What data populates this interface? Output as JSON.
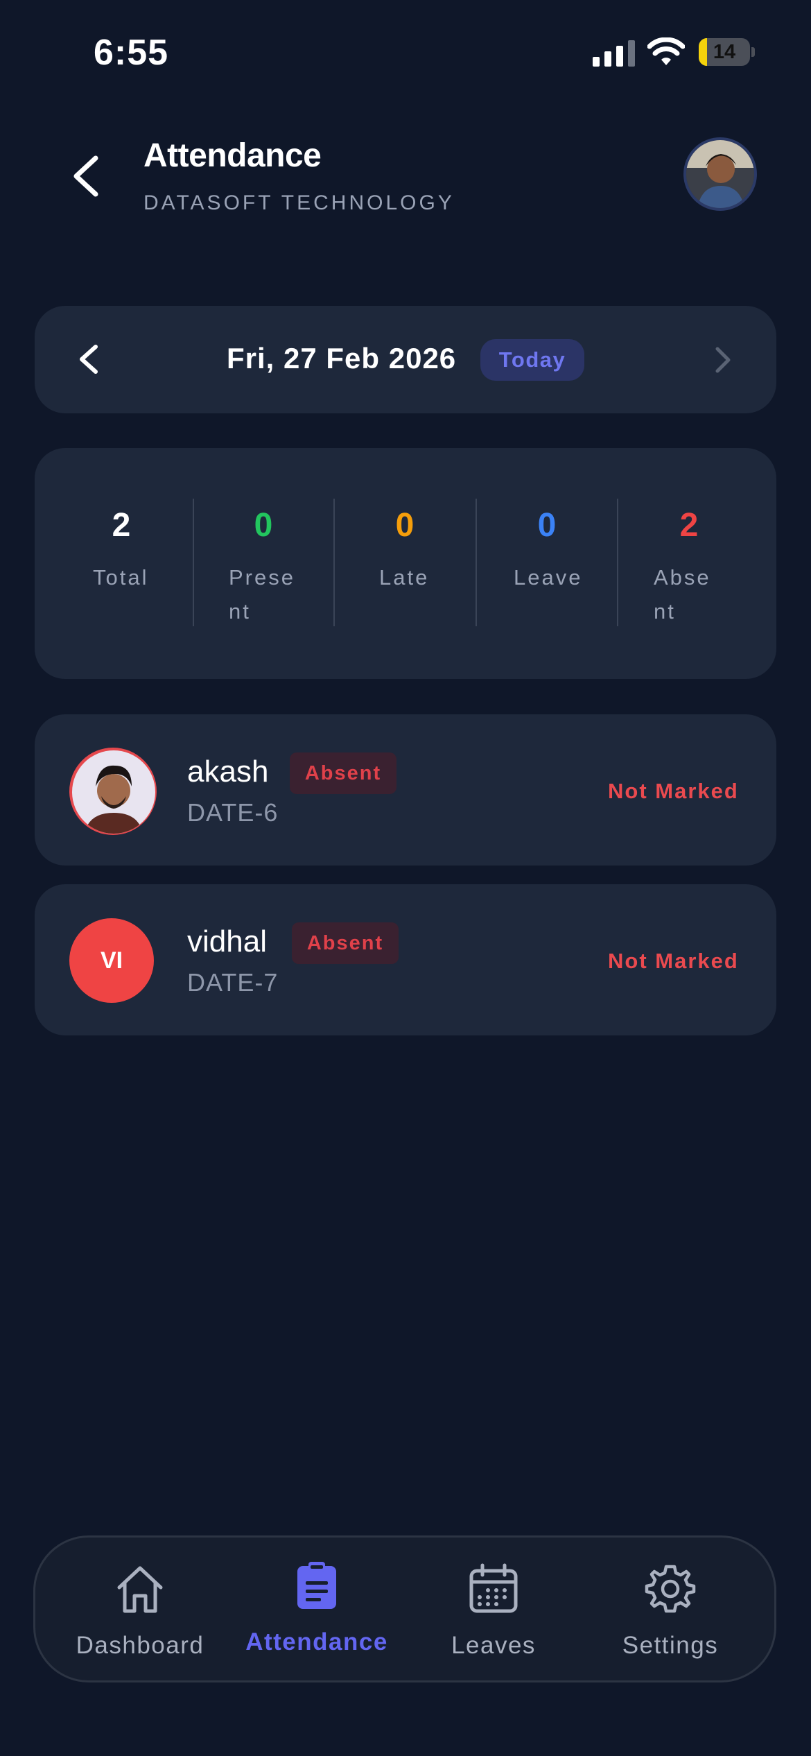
{
  "status_bar": {
    "time": "6:55",
    "battery": "14"
  },
  "header": {
    "title": "Attendance",
    "subtitle": "DATASOFT TECHNOLOGY"
  },
  "date_selector": {
    "date": "Fri, 27 Feb 2026",
    "badge": "Today"
  },
  "stats": [
    {
      "value": "2",
      "label_line1": "Total",
      "label_line2": "",
      "color": "#ffffff"
    },
    {
      "value": "0",
      "label_line1": "Prese",
      "label_line2": "nt",
      "color": "#22c55e"
    },
    {
      "value": "0",
      "label_line1": "Late",
      "label_line2": "",
      "color": "#f59e0b"
    },
    {
      "value": "0",
      "label_line1": "Leave",
      "label_line2": "",
      "color": "#3b82f6"
    },
    {
      "value": "2",
      "label_line1": "Abse",
      "label_line2": "nt",
      "color": "#ef4444"
    }
  ],
  "employees": [
    {
      "name": "akash",
      "status": "Absent",
      "code": "DATE-6",
      "mark": "Not Marked",
      "initials": ""
    },
    {
      "name": "vidhal",
      "status": "Absent",
      "code": "DATE-7",
      "mark": "Not Marked",
      "initials": "VI"
    }
  ],
  "nav": {
    "items": [
      {
        "label": "Dashboard",
        "icon": "home-icon",
        "active": false
      },
      {
        "label": "Attendance",
        "icon": "clipboard-icon",
        "active": true
      },
      {
        "label": "Leaves",
        "icon": "calendar-icon",
        "active": false
      },
      {
        "label": "Settings",
        "icon": "gear-icon",
        "active": false
      }
    ],
    "active_color": "#6366f1"
  }
}
